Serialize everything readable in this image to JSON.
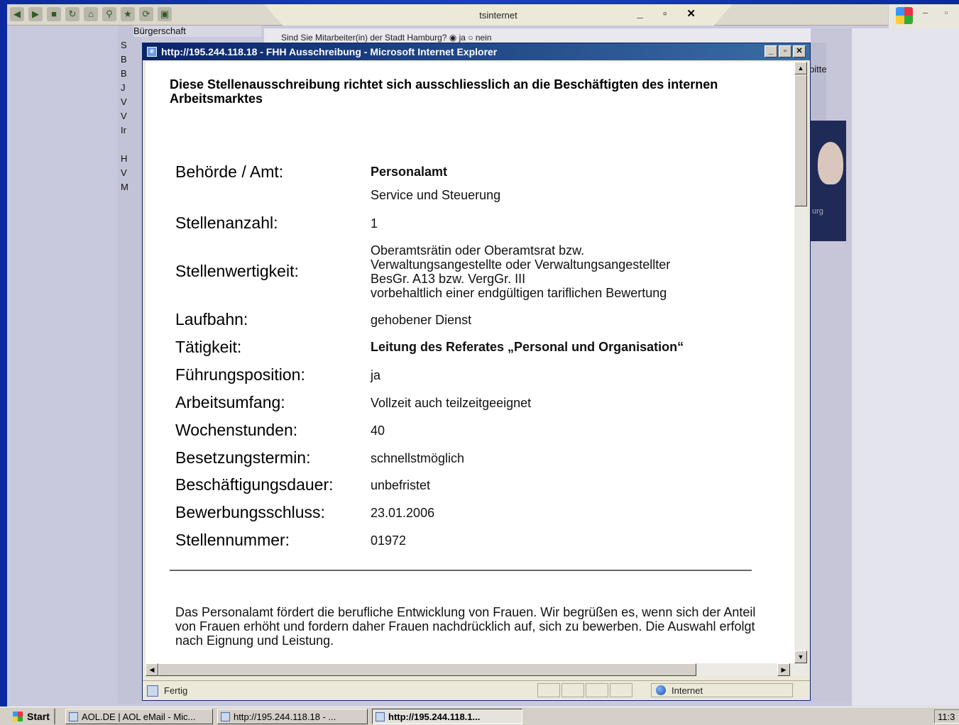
{
  "outer_window": {
    "tab_title": "tsinternet",
    "tab_controls": "_ ▫ ✕",
    "right_controls": "– ▫"
  },
  "background_page": {
    "top_nav_item": "Bürgerschaft",
    "left_nav_letters": [
      "S",
      "B",
      "B",
      "J",
      "V",
      "V",
      "Ir",
      "",
      "H",
      "V",
      "M"
    ],
    "question": "Sind Sie Mitarbeiter(in) der Stadt Hamburg?  ◉ ja  ○ nein",
    "right_fragment": "bitte",
    "right_dark_fragment": "urg"
  },
  "popup": {
    "title": "http://195.244.118.18 - FHH Ausschreibung - Microsoft Internet Explorer",
    "controls": [
      "_",
      "▫",
      "✕"
    ],
    "intro": "Diese Stellenausschreibung richtet sich ausschliesslich an die Beschäftigten des internen Arbeitsmarktes",
    "fields": [
      {
        "label": "Behörde / Amt:",
        "value": "Personalamt",
        "bold": true
      },
      {
        "label": "",
        "value": "Service und Steuerung",
        "bold": false
      },
      {
        "label": "Stellenanzahl:",
        "value": "1",
        "bold": false
      },
      {
        "label": "Stellenwertigkeit:",
        "value_lines": [
          "Oberamtsrätin oder Oberamtsrat bzw.",
          "Verwaltungsangestellte oder Verwaltungsangestellter",
          "BesGr. A13 bzw.  VergGr. III",
          "vorbehaltlich einer endgültigen tariflichen Bewertung"
        ]
      },
      {
        "label": "Laufbahn:",
        "value": "gehobener Dienst",
        "bold": false
      },
      {
        "label": "Tätigkeit:",
        "value": "Leitung des Referates „Personal und Organisation“",
        "bold": true
      },
      {
        "label": "Führungsposition:",
        "value": "ja",
        "bold": false
      },
      {
        "label": "Arbeitsumfang:",
        "value": "Vollzeit auch teilzeitgeeignet",
        "bold": false
      },
      {
        "label": "Wochenstunden:",
        "value": "40",
        "bold": false
      },
      {
        "label": "Besetzungstermin:",
        "value": "schnellstmöglich",
        "bold": false
      },
      {
        "label": "Beschäftigungsdauer:",
        "value": "unbefristet",
        "bold": false
      },
      {
        "label": "Bewerbungsschluss:",
        "value": "23.01.2006",
        "bold": false
      },
      {
        "label": "Stellennummer:",
        "value": "01972",
        "bold": false
      }
    ],
    "note": "Das Personalamt fördert die berufliche Entwicklung von Frauen. Wir begrüßen es, wenn sich der Anteil von Frauen erhöht und fordern daher Frauen nachdrücklich auf, sich zu bewerben. Die Auswahl erfolgt nach Eignung und Leistung.",
    "status_text": "Fertig",
    "status_zone": "Internet"
  },
  "taskbar": {
    "start_label": "Start",
    "tasks": [
      {
        "label": "AOL.DE | AOL eMail - Mic...",
        "active": false
      },
      {
        "label": "http://195.244.118.18 - ...",
        "active": false
      },
      {
        "label": "http://195.244.118.1...",
        "active": true
      }
    ],
    "clock": "11:3"
  },
  "colors": {
    "titlebar": "#0a246a",
    "desktop": "#0b2aa0"
  }
}
